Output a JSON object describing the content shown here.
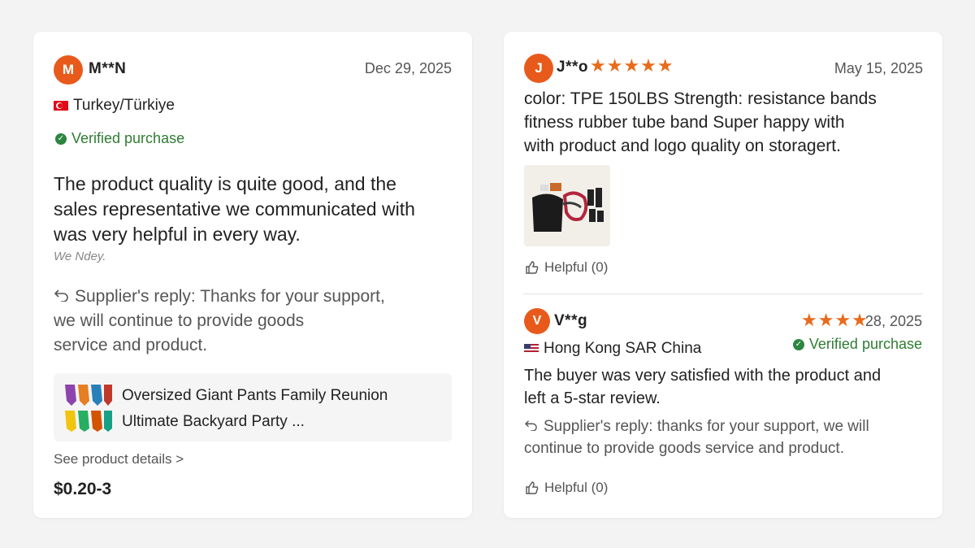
{
  "review1": {
    "avatar_letter": "M",
    "name": "M**N",
    "date": "Dec 29, 2025",
    "country": "Turkey/Türkiye",
    "verified": "Verified purchase",
    "text_lines": [
      "The product quality is quite good, and the",
      "sales representative we communicated with",
      "was very helpful in every way."
    ],
    "faint_text": "We Ndey.",
    "reply_lines": [
      "Supplier's reply: Thanks for your support,",
      "we will continue to provide goods",
      "service and product."
    ],
    "product_title_lines": [
      "Oversized Giant Pants Family Reunion",
      "Ultimate Backyard Party ..."
    ],
    "see_details": "See product details >",
    "price": "$0.20-3"
  },
  "review2": {
    "avatar_letter": "J",
    "name": "J**o",
    "rating": 5,
    "stars": "★★★★★",
    "date": "May 15, 2025",
    "text_lines": [
      "color: TPE 150LBS Strength: resistance bands",
      "fitness rubber tube band Super happy with",
      "with product and logo quality on storagert."
    ],
    "helpful": "Helpful (0)"
  },
  "review3": {
    "avatar_letter": "V",
    "name": "V**g",
    "rating": 4,
    "stars": "★★★★",
    "date": "28, 2025",
    "country": "Hong Kong SAR China",
    "verified": "Verified purchase",
    "text_lines": [
      "The buyer was very satisfied with the product and",
      "left a 5-star review."
    ],
    "reply_lines": [
      "Supplier's reply: thanks for your support, we will",
      "continue to provide goods service and product."
    ],
    "helpful": "Helpful (0)"
  },
  "colors": {
    "accent": "#e85a1b",
    "star": "#e86b1b",
    "verified": "#2e7d32"
  },
  "icons": {
    "reply": "reply-arrow-icon",
    "helpful": "thumbs-up-icon",
    "verified": "check-circle-icon"
  }
}
